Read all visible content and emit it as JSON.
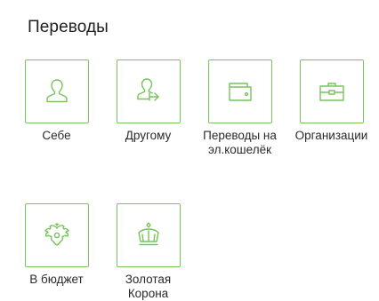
{
  "section": {
    "title": "Переводы"
  },
  "tiles": [
    {
      "label": "Себе",
      "icon": "person-icon"
    },
    {
      "label": "Другому",
      "icon": "person-transfer-icon"
    },
    {
      "label": "Переводы на\nэл.кошелёк",
      "icon": "wallet-icon"
    },
    {
      "label": "Организации",
      "icon": "briefcase-icon"
    },
    {
      "label": "В бюджет",
      "icon": "double-headed-eagle-icon"
    },
    {
      "label": "Золотая\nКорона",
      "icon": "crown-icon"
    }
  ],
  "colors": {
    "accent": "#76c45b",
    "text": "#2a2a2a",
    "background": "#ffffff"
  }
}
